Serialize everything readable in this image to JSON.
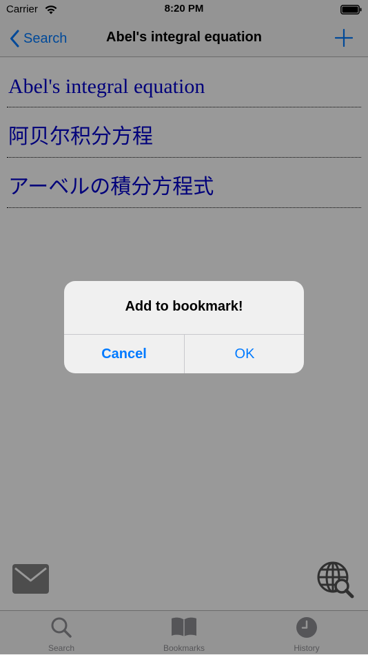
{
  "status_bar": {
    "carrier": "Carrier",
    "time": "8:20 PM"
  },
  "nav": {
    "back_label": "Search",
    "title": "Abel's integral equation"
  },
  "entries": [
    {
      "text": "Abel's integral equation"
    },
    {
      "text": "阿贝尔积分方程"
    },
    {
      "text": "アーベルの積分方程式"
    }
  ],
  "alert": {
    "title": "Add to bookmark!",
    "cancel_label": "Cancel",
    "ok_label": "OK"
  },
  "tabs": [
    {
      "label": "Search",
      "icon": "search-icon"
    },
    {
      "label": "Bookmarks",
      "icon": "book-icon"
    },
    {
      "label": "History",
      "icon": "clock-icon"
    }
  ],
  "colors": {
    "accent": "#007aff",
    "entry_text": "#0000cc",
    "tab_inactive": "#8e8e93"
  }
}
